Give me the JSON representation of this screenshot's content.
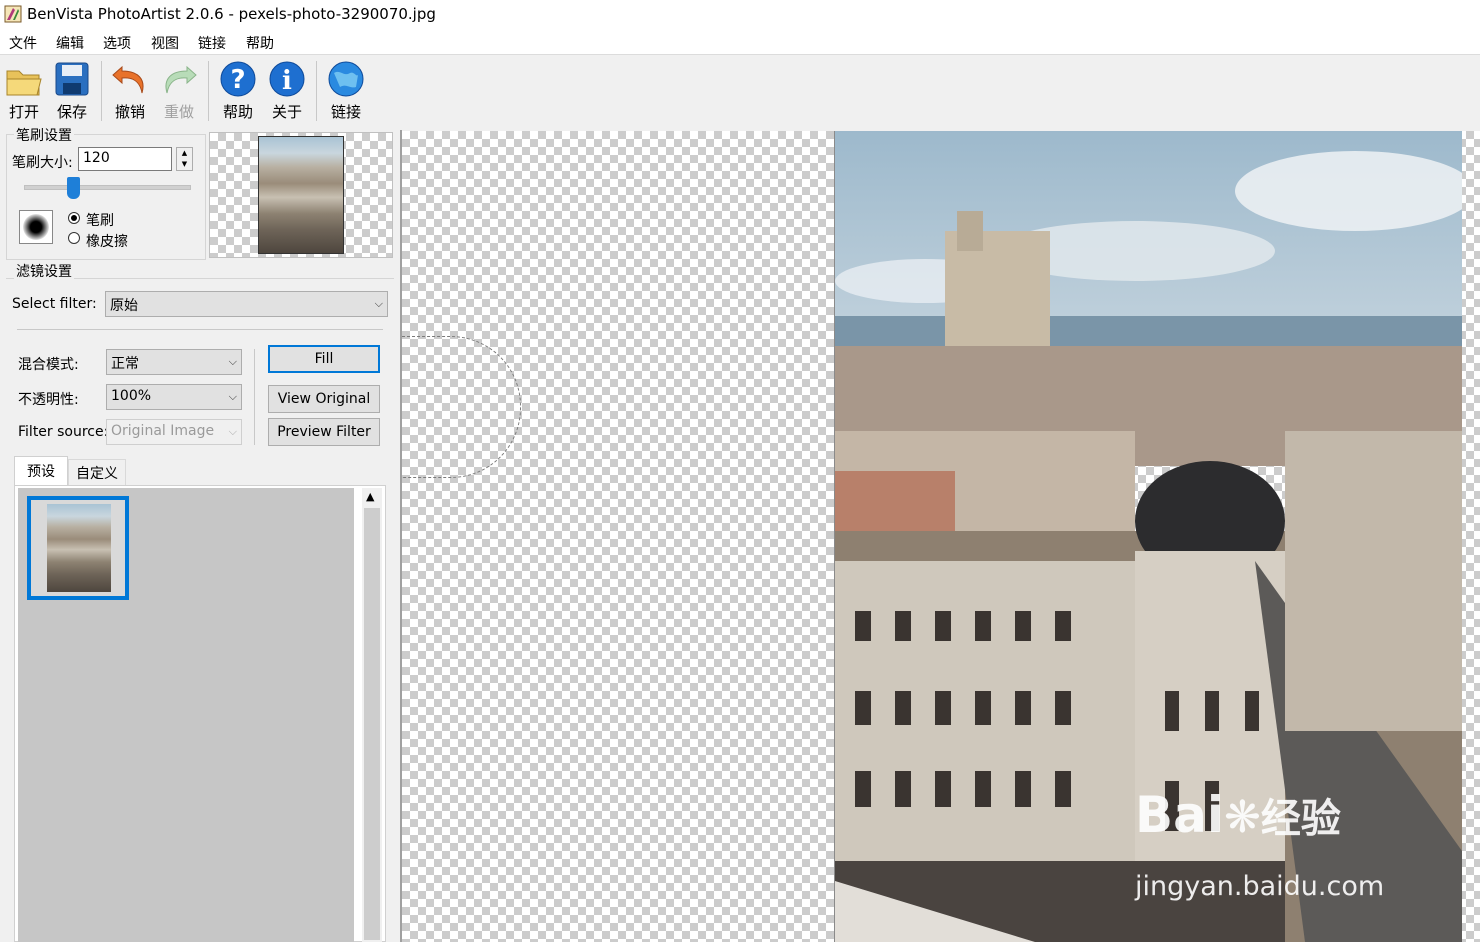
{
  "window": {
    "title": "BenVista PhotoArtist 2.0.6 - pexels-photo-3290070.jpg"
  },
  "menu": {
    "items": [
      "文件",
      "编辑",
      "选项",
      "视图",
      "链接",
      "帮助"
    ]
  },
  "toolbar": {
    "open": "打开",
    "save": "保存",
    "undo": "撤销",
    "redo": "重做",
    "help": "帮助",
    "about": "关于",
    "link": "链接"
  },
  "brush": {
    "group_label": "笔刷设置",
    "size_label": "笔刷大小:",
    "size_value": "120",
    "radio_brush": "笔刷",
    "radio_eraser": "橡皮擦",
    "selected": "笔刷"
  },
  "filter": {
    "group_label": "滤镜设置",
    "select_label": "Select filter:",
    "select_value": "原始",
    "blend_label": "混合模式:",
    "blend_value": "正常",
    "opacity_label": "不透明性:",
    "opacity_value": "100%",
    "source_label": "Filter source:",
    "source_value": "Original Image",
    "fill_button": "Fill",
    "view_original_button": "View Original",
    "preview_filter_button": "Preview Filter"
  },
  "tabs": {
    "items": [
      "预设",
      "自定义"
    ],
    "active": "预设"
  },
  "watermark": {
    "brand": "Bai",
    "brand_cn": "经验",
    "url": "jingyan.baidu.com"
  },
  "colors": {
    "accent": "#1e7fd8",
    "selection": "#0078d7"
  }
}
